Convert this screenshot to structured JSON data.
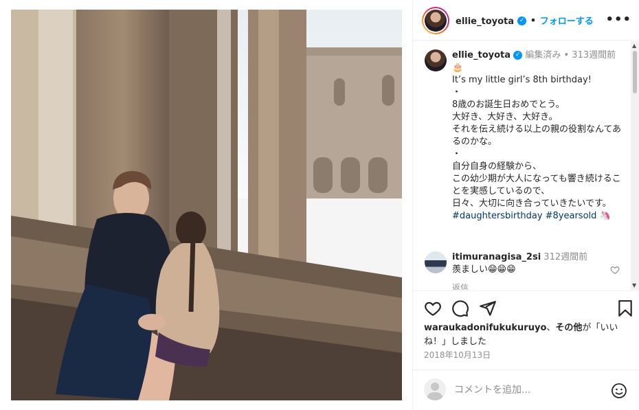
{
  "header": {
    "username": "ellie_toyota",
    "separator": "•",
    "follow_label": "フォローする",
    "more_label": "•••"
  },
  "caption": {
    "username": "ellie_toyota",
    "edited": "編集済み",
    "separator": "•",
    "age": "313週間前",
    "emoji": "🎂",
    "lines": [
      "It’s my little girl’s 8th birthday!",
      "・",
      "8歳のお誕生日おめでとう。",
      "大好き、大好き、大好き。",
      "それを伝え続ける以上の親の役割なんてあるのかな。",
      "・",
      "自分自身の経験から、",
      "この幼少期が大人になっても響き続けることを実感しているので、",
      "日々、大切に向き合っていきたいです。"
    ],
    "hashtags": "#daughtersbirthday #8yearsold",
    "hashtag_emoji": "🦄"
  },
  "comment": {
    "username": "itimuranagisa_2si",
    "age": "312週間前",
    "text": "羨ましい😁😁😁",
    "reply_label": "返信"
  },
  "likes": {
    "user": "waraukadonifukukuruyo",
    "mid": "、",
    "others": "その他",
    "suffix": "が「いいね！」しました"
  },
  "date": "2018年10月13日",
  "add_comment": {
    "placeholder": "コメントを追加..."
  },
  "icons": [
    "heart-icon",
    "comment-icon",
    "share-icon",
    "bookmark-icon",
    "emoji-icon",
    "verified-icon",
    "more-icon"
  ],
  "colors": {
    "accent": "#0095f6",
    "text": "#262626",
    "muted": "#8e8e8e",
    "hashtag": "#00376b"
  }
}
